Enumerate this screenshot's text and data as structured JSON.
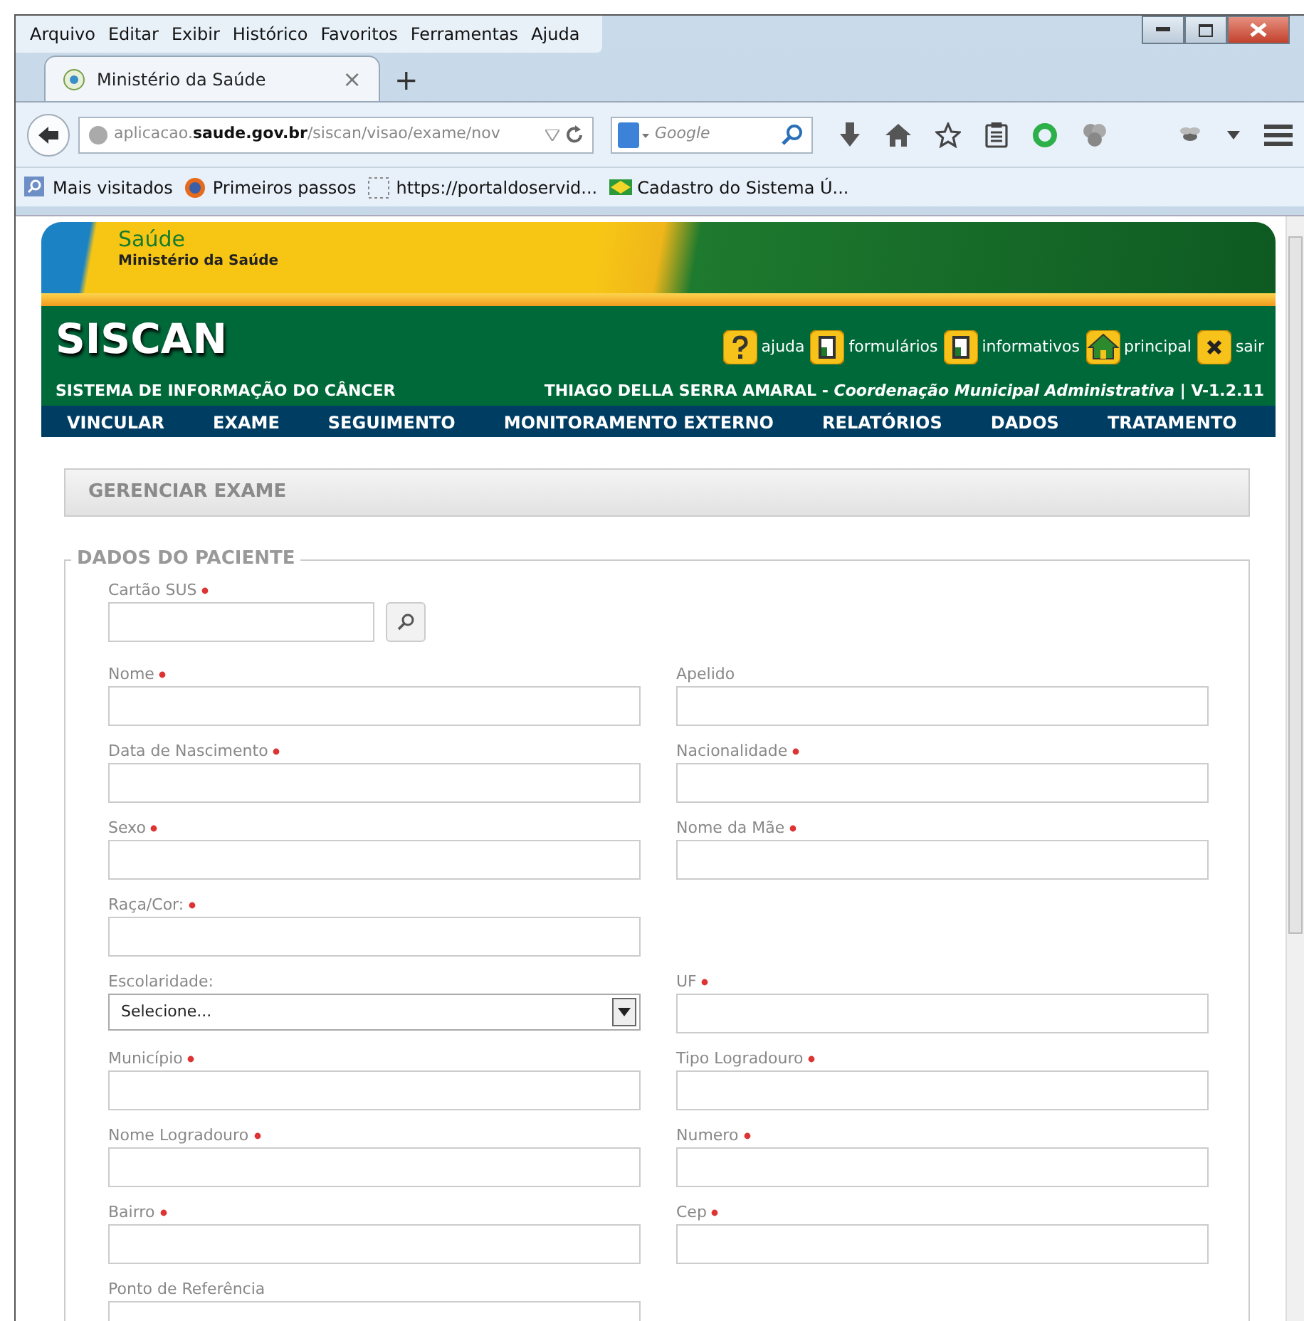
{
  "browser": {
    "menu": [
      "Arquivo",
      "Editar",
      "Exibir",
      "Histórico",
      "Favoritos",
      "Ferramentas",
      "Ajuda"
    ],
    "tab": {
      "title": "Ministério da Saúde",
      "close": "×",
      "new_tab": "+"
    },
    "url": "aplicacao.**saude.gov.br**/siscan/visao/exame/nov",
    "search": {
      "placeholder": "Google"
    },
    "bookmarks": [
      {
        "label": "Mais visitados",
        "kind": "search"
      },
      {
        "label": "Primeiros passos",
        "kind": "fox"
      },
      {
        "label": "https://portaldoservid...",
        "kind": "blank"
      },
      {
        "label": "Cadastro do Sistema Ú...",
        "kind": "flag"
      }
    ]
  },
  "site": {
    "brand": "Saúde",
    "ministry": "Ministério da Saúde",
    "app": "SISCAN",
    "subtitle": "SISTEMA DE INFORMAÇÃO DO CÂNCER",
    "links": [
      {
        "label": "ajuda",
        "kind": "help"
      },
      {
        "label": "formulários",
        "kind": "doc"
      },
      {
        "label": "informativos",
        "kind": "doc"
      },
      {
        "label": "principal",
        "kind": "home"
      },
      {
        "label": "sair",
        "kind": "exit"
      }
    ],
    "user_line": "THIAGO DELLA SERRA AMARAL - *Coordenação Municipal Administrativa* | V-1.2.11",
    "nav": [
      "VINCULAR",
      "EXAME",
      "SEGUIMENTO",
      "MONITORAMENTO EXTERNO",
      "RELATÓRIOS",
      "DADOS",
      "TRATAMENTO"
    ]
  },
  "panel_title": "GERENCIAR EXAME",
  "section": {
    "legend": "DADOS DO PACIENTE",
    "card_field": {
      "label": "Cartão SUS",
      "required": true
    },
    "rows": [
      {
        "left": {
          "label": "Nome",
          "required": true,
          "kind": "text"
        },
        "right": {
          "label": "Apelido",
          "required": false,
          "kind": "text"
        }
      },
      {
        "left": {
          "label": "Data de Nascimento",
          "required": true,
          "kind": "text"
        },
        "right": {
          "label": "Nacionalidade",
          "required": true,
          "kind": "text"
        }
      },
      {
        "left": {
          "label": "Sexo",
          "required": true,
          "kind": "text"
        },
        "right": {
          "label": "Nome da Mãe",
          "required": true,
          "kind": "text"
        }
      },
      {
        "left": {
          "label": "Raça/Cor:",
          "required": true,
          "kind": "text"
        }
      },
      {
        "left": {
          "label": "Escolaridade:",
          "required": false,
          "kind": "select",
          "value": "Selecione..."
        },
        "right": {
          "label": "UF",
          "required": true,
          "kind": "text"
        }
      },
      {
        "left": {
          "label": "Município",
          "required": true,
          "kind": "text"
        },
        "right": {
          "label": "Tipo Logradouro",
          "required": true,
          "kind": "text"
        }
      },
      {
        "left": {
          "label": "Nome Logradouro",
          "required": true,
          "kind": "text"
        },
        "right": {
          "label": "Numero",
          "required": true,
          "kind": "text"
        }
      },
      {
        "left": {
          "label": "Bairro",
          "required": true,
          "kind": "text"
        },
        "right": {
          "label": "Cep",
          "required": true,
          "kind": "text"
        }
      },
      {
        "left": {
          "label": "Ponto de Referência",
          "required": false,
          "kind": "text"
        }
      }
    ]
  }
}
